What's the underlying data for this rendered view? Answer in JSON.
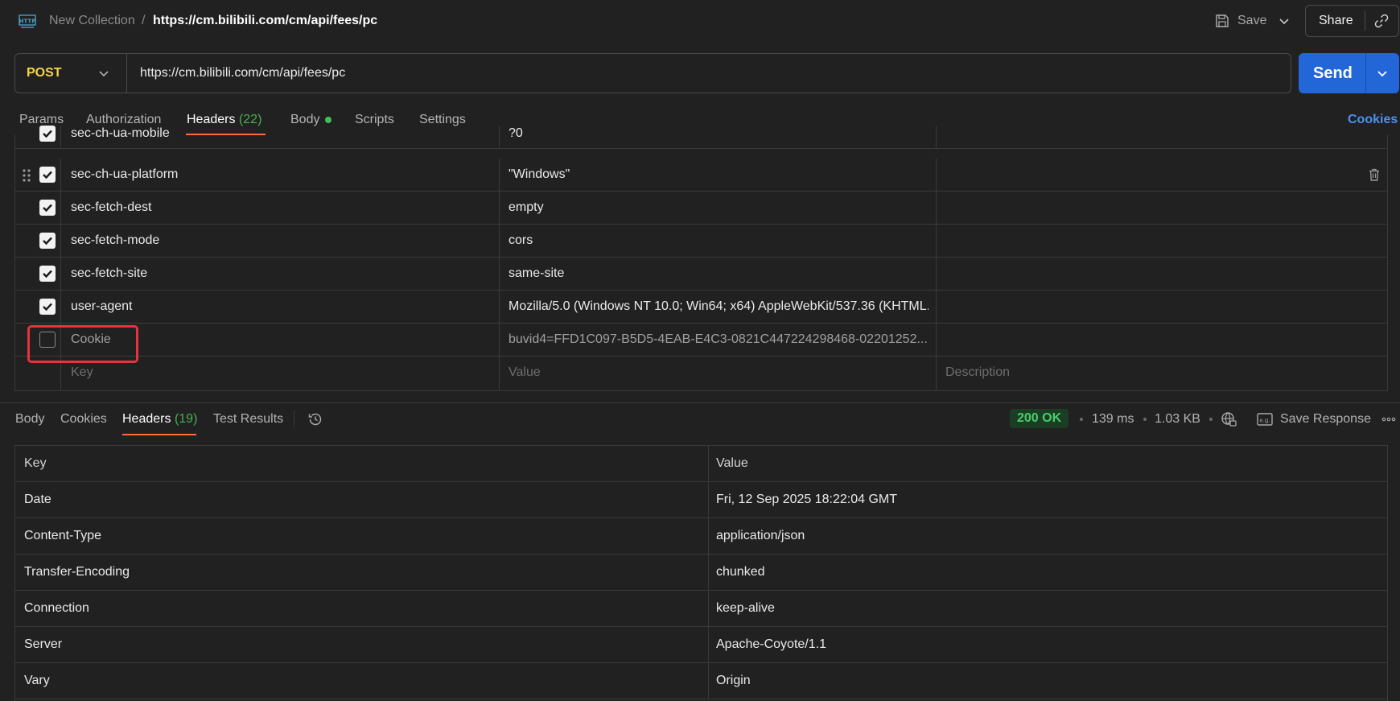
{
  "breadcrumb": {
    "collection": "New Collection",
    "separator": "/",
    "request_name": "https://cm.bilibili.com/cm/api/fees/pc"
  },
  "toolbar": {
    "save_label": "Save",
    "share_label": "Share"
  },
  "request": {
    "method": "POST",
    "url": "https://cm.bilibili.com/cm/api/fees/pc",
    "send_label": "Send"
  },
  "request_tabs": {
    "params": "Params",
    "authorization": "Authorization",
    "headers": "Headers",
    "headers_count": "(22)",
    "body": "Body",
    "scripts": "Scripts",
    "settings": "Settings",
    "cookies": "Cookies"
  },
  "request_headers": {
    "rows": [
      {
        "key": "sec-ch-ua-mobile",
        "value": "?0",
        "checked": true
      },
      {
        "key": "sec-ch-ua-platform",
        "value": "\"Windows\"",
        "checked": true
      },
      {
        "key": "sec-fetch-dest",
        "value": "empty",
        "checked": true
      },
      {
        "key": "sec-fetch-mode",
        "value": "cors",
        "checked": true
      },
      {
        "key": "sec-fetch-site",
        "value": "same-site",
        "checked": true
      },
      {
        "key": "user-agent",
        "value": "Mozilla/5.0 (Windows NT 10.0; Win64; x64) AppleWebKit/537.36 (KHTML...",
        "checked": true
      },
      {
        "key": "Cookie",
        "value": "buvid4=FFD1C097-B5D5-4EAB-E4C3-0821C447224298468-02201252...",
        "checked": false
      }
    ],
    "placeholder_key": "Key",
    "placeholder_value": "Value",
    "placeholder_description": "Description"
  },
  "response_tabs": {
    "body": "Body",
    "cookies": "Cookies",
    "headers": "Headers",
    "headers_count": "(19)",
    "test_results": "Test Results"
  },
  "response_meta": {
    "status": "200 OK",
    "time": "139 ms",
    "size": "1.03 KB",
    "save_response": "Save Response"
  },
  "response_headers": {
    "col_key": "Key",
    "col_value": "Value",
    "rows": [
      {
        "key": "Date",
        "value": "Fri, 12 Sep 2025 18:22:04 GMT"
      },
      {
        "key": "Content-Type",
        "value": "application/json"
      },
      {
        "key": "Transfer-Encoding",
        "value": "chunked"
      },
      {
        "key": "Connection",
        "value": "keep-alive"
      },
      {
        "key": "Server",
        "value": "Apache-Coyote/1.1"
      },
      {
        "key": "Vary",
        "value": "Origin"
      }
    ]
  },
  "colors": {
    "accent_orange": "#ff6c37",
    "send_blue": "#2366d8",
    "method_yellow": "#f5d547",
    "status_green": "#4ccb6c",
    "highlight_red": "#e8323c"
  },
  "icons": [
    "http-icon",
    "save-icon",
    "chevron-down-icon",
    "link-icon",
    "drag-handle-icon",
    "trash-icon",
    "history-icon",
    "globe-icon",
    "example-icon",
    "more-icon"
  ]
}
